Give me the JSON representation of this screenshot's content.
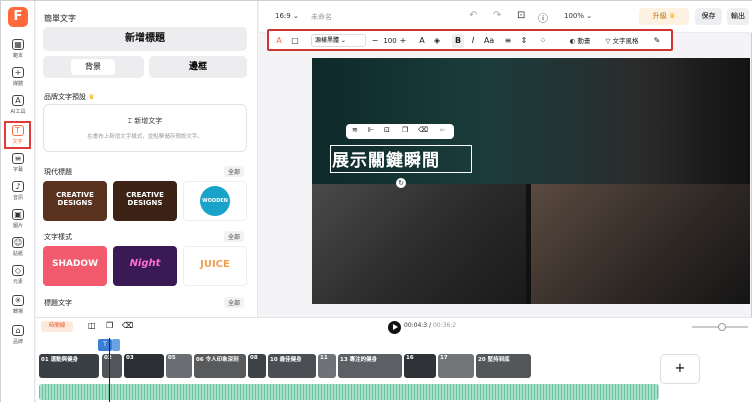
{
  "rail": [
    {
      "label": "範本",
      "glyph": "▦"
    },
    {
      "label": "媒體",
      "glyph": "+"
    },
    {
      "label": "AI工具",
      "glyph": "A"
    },
    {
      "label": "文字",
      "glyph": "T"
    },
    {
      "label": "字幕",
      "glyph": "≡"
    },
    {
      "label": "音訊",
      "glyph": "♪"
    },
    {
      "label": "圖片",
      "glyph": "▣"
    },
    {
      "label": "貼紙",
      "glyph": "☺"
    },
    {
      "label": "元素",
      "glyph": "◇"
    },
    {
      "label": "轉場",
      "glyph": "✳"
    },
    {
      "label": "品牌",
      "glyph": "⌂"
    }
  ],
  "panel": {
    "title": "簡單文字",
    "add_heading": "新增標題",
    "bg_label": "背景",
    "border_label": "邊框",
    "brand_section": "品牌文字預設",
    "preset_button": "新增文字",
    "preset_hint": "在畫布上新增文字樣式，並點擊儲存預設文字。",
    "modern_section": "現代標題",
    "all": "全部",
    "modern_thumbs": [
      "CREATIVE DESIGNS",
      "CREATIVE DESIGNS",
      "WOODEN"
    ],
    "style_section": "文字樣式",
    "style_thumbs": [
      "SHADOW",
      "Night",
      "JUICE"
    ],
    "more_section": "標題文字"
  },
  "topbar": {
    "ratio": "16:9",
    "project_name": "未命名",
    "zoom": "100%",
    "upgrade": "升級",
    "save": "保存",
    "export": "輸出"
  },
  "toolbar": {
    "font": "源樣黑體",
    "size": "100",
    "bold": "B",
    "italic": "I",
    "case": "Aa",
    "animation": "動畫",
    "text_style": "文字風格"
  },
  "canvas": {
    "headline": "展示關鍵瞬間"
  },
  "timeline": {
    "track_label": "時間線",
    "time_current": "00:04:3",
    "time_total": "00:36:2",
    "clips": [
      "01 運動與健身",
      "02",
      "03",
      "05",
      "06 令人印象深刻",
      "08",
      "10 最佳健身",
      "11",
      "13 專注的健身",
      "16",
      "17",
      "20 堅持到底"
    ],
    "add": "+"
  }
}
